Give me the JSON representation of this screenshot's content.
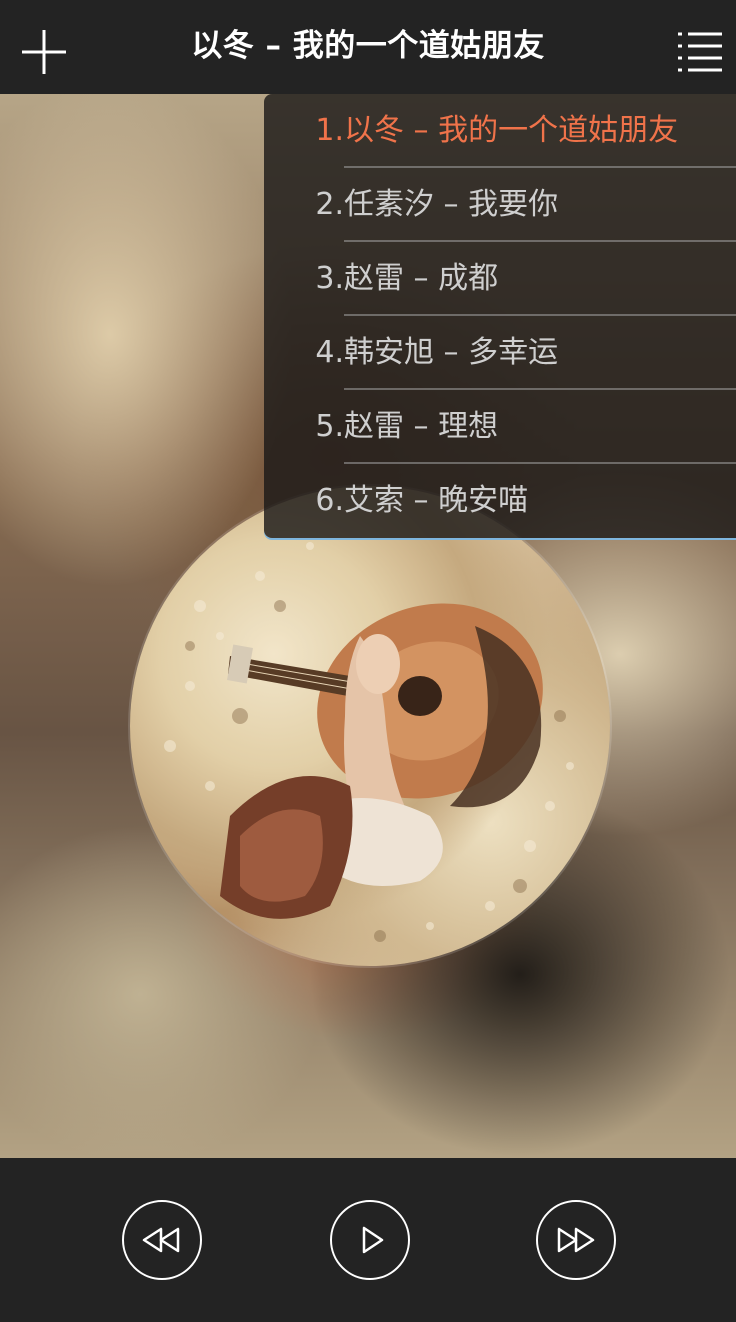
{
  "header": {
    "add_icon": "plus-icon",
    "title": "以冬 – 我的一个道姑朋友",
    "menu_icon": "list-menu-icon"
  },
  "playlist": {
    "items": [
      {
        "num": "1.",
        "label": "以冬 – 我的一个道姑朋友",
        "active": true
      },
      {
        "num": "2.",
        "label": "任素汐 – 我要你",
        "active": false
      },
      {
        "num": "3.",
        "label": "赵雷 – 成都",
        "active": false
      },
      {
        "num": "4.",
        "label": "韩安旭 – 多幸运",
        "active": false
      },
      {
        "num": "5.",
        "label": "赵雷 – 理想",
        "active": false
      },
      {
        "num": "6.",
        "label": "艾索 – 晚安喵",
        "active": false
      }
    ],
    "active_color": "#f0734a",
    "text_color": "#cfcfcf"
  },
  "controls": {
    "prev_icon": "rewind-icon",
    "play_icon": "play-icon",
    "next_icon": "fast-forward-icon"
  },
  "colors": {
    "bar_bg": "#232323",
    "accent": "#f0734a",
    "overlay_edge": "#7fb6de"
  }
}
